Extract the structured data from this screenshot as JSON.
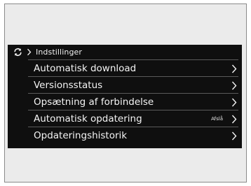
{
  "header": {
    "sync_icon": "sync-icon",
    "chevron_icon": "chevron-right-icon",
    "title": "Indstillinger"
  },
  "menu": [
    {
      "label": "Automatisk download",
      "value": ""
    },
    {
      "label": "Versionsstatus",
      "value": ""
    },
    {
      "label": "Opsætning af forbindelse",
      "value": ""
    },
    {
      "label": "Automatisk opdatering",
      "value": "Afslå"
    },
    {
      "label": "Opdateringshistorik",
      "value": ""
    }
  ],
  "colors": {
    "screen_bg": "#0f0f0f",
    "frame_bg": "#ebebeb",
    "divider": "#5a5a5a",
    "text": "#f4f4f4"
  }
}
